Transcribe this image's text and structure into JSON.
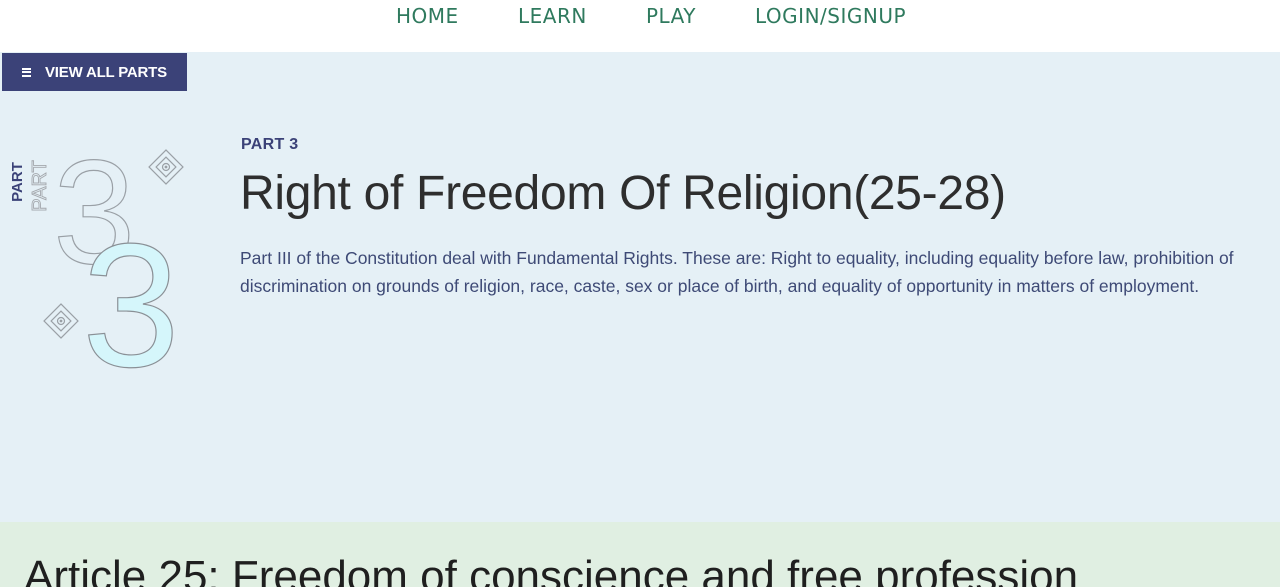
{
  "nav": {
    "items": [
      {
        "label": "HOME"
      },
      {
        "label": "LEARN"
      },
      {
        "label": "PLAY"
      },
      {
        "label": "LOGIN/SIGNUP"
      }
    ]
  },
  "hero": {
    "view_all_label": "VIEW ALL PARTS",
    "art": {
      "vertical_label_primary": "PART",
      "vertical_label_secondary": "PART",
      "numeral_outline": "3",
      "numeral_filled": "3",
      "numeral_filled_color": "#d5f6fb"
    },
    "eyebrow": "PART 3",
    "title": "Right of Freedom Of Religion(25-28)",
    "description": "Part III of the Constitution deal with Fundamental Rights. These are: Right to equality, including equality before law, prohibition of discrimination on grounds of religion, race, caste, sex or place of birth, and equality of opportunity in matters of employment."
  },
  "article": {
    "heading": "Article 25: Freedom of conscience and free profession"
  },
  "colors": {
    "nav_text": "#2f7a5e",
    "hero_bg": "#e5f0f6",
    "button_bg": "#3b4278",
    "article_bg": "#e0efe2"
  }
}
